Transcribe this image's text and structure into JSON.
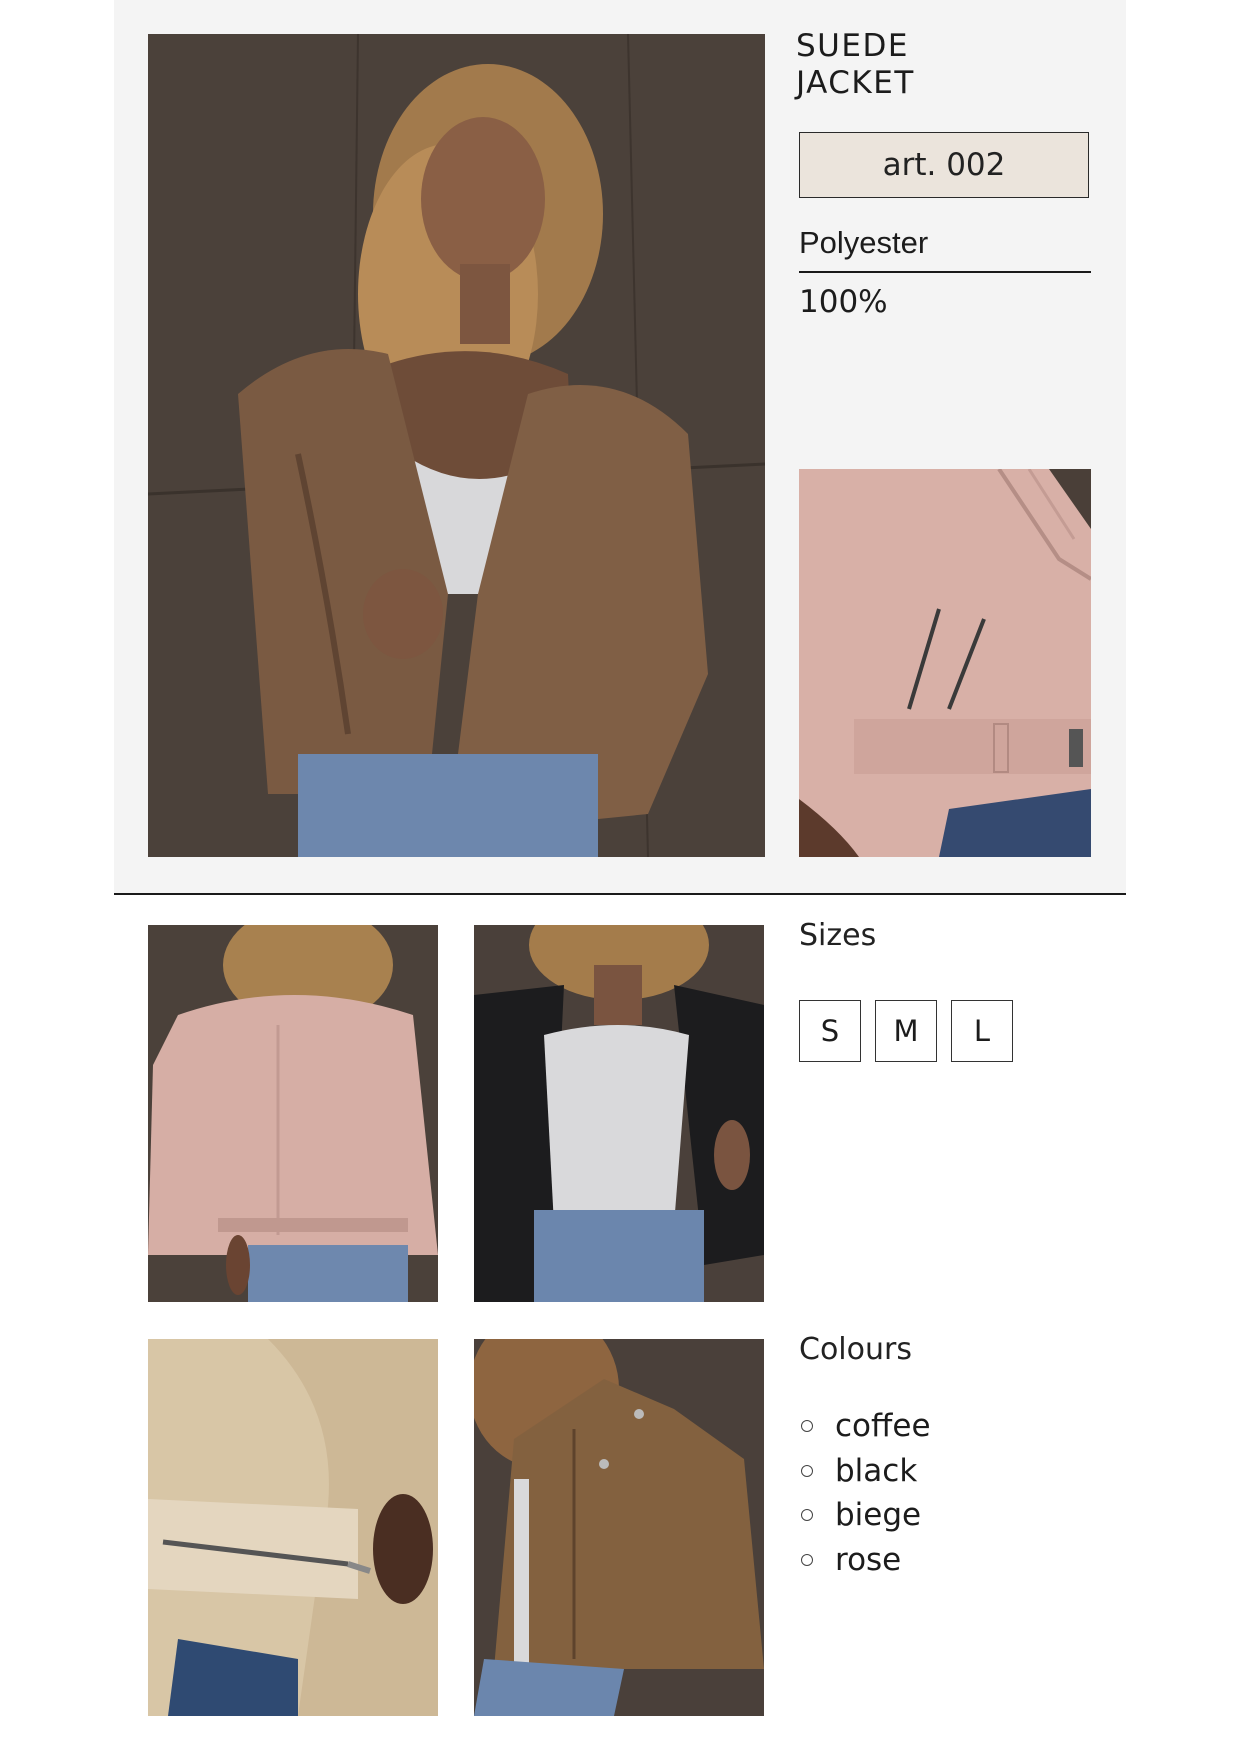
{
  "product": {
    "title_line1": "SUEDE",
    "title_line2": "JACKET",
    "article": "art. 002",
    "material": "Polyester",
    "material_percent": "100%"
  },
  "sizes": {
    "label": "Sizes",
    "options": [
      "S",
      "M",
      "L"
    ]
  },
  "colours": {
    "label": "Colours",
    "options": [
      "coffee",
      "black",
      "biege",
      "rose"
    ]
  },
  "photos": {
    "main": "coffee-jacket-model-front",
    "detail": "rose-jacket-zip-detail",
    "back": "rose-jacket-back",
    "black": "black-jacket-open",
    "sleeve": "beige-jacket-sleeve-zip",
    "coffee": "coffee-jacket-model"
  },
  "palette": {
    "panel_bg": "#f4f4f4",
    "art_box_bg": "#ebe4dc",
    "coffee": "#8a6547",
    "rose": "#d9b1a9",
    "beige": "#d9c7a8",
    "black": "#1d1d1f",
    "wall": "#4a4039",
    "denim": "#6c86ad"
  }
}
